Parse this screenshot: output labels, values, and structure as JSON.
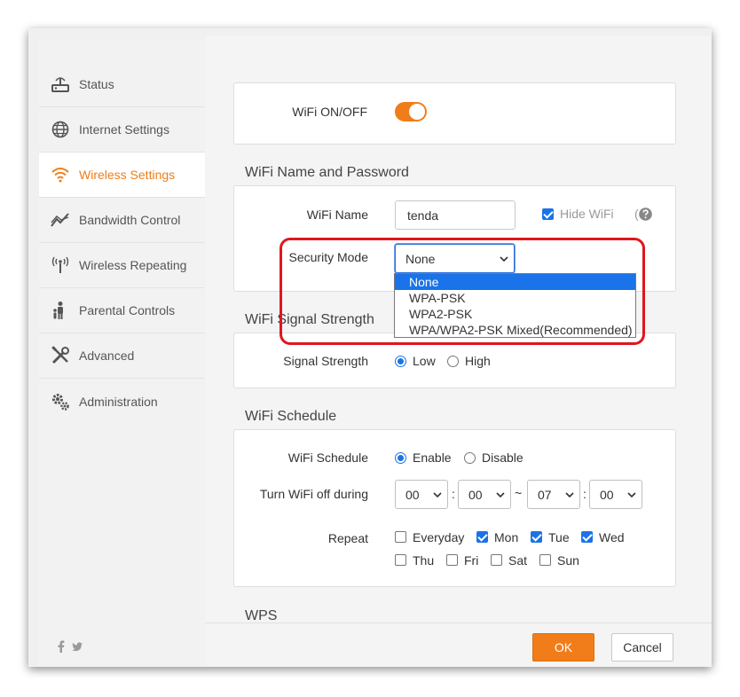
{
  "sidebar": {
    "items": [
      {
        "label": "Status",
        "icon": "router-icon"
      },
      {
        "label": "Internet Settings",
        "icon": "globe-icon"
      },
      {
        "label": "Wireless Settings",
        "icon": "wifi-icon",
        "active": true
      },
      {
        "label": "Bandwidth Control",
        "icon": "chart-line-icon"
      },
      {
        "label": "Wireless Repeating",
        "icon": "antenna-icon"
      },
      {
        "label": "Parental Controls",
        "icon": "family-icon"
      },
      {
        "label": "Advanced",
        "icon": "tools-icon"
      },
      {
        "label": "Administration",
        "icon": "gears-icon"
      }
    ],
    "social": [
      "facebook-icon",
      "twitter-icon"
    ]
  },
  "wifi_switch": {
    "label": "WiFi ON/OFF",
    "state": "on"
  },
  "name_password": {
    "title": "WiFi Name and Password",
    "name_label": "WiFi Name",
    "name_value": "tenda",
    "hide_label": "Hide WiFi",
    "hide_checked": true,
    "help_open": "(",
    "security_label": "Security Mode",
    "security_value": "None",
    "security_options": [
      "None",
      "WPA-PSK",
      "WPA2-PSK",
      "WPA/WPA2-PSK Mixed(Recommended)"
    ]
  },
  "signal": {
    "title": "WiFi Signal Strength",
    "label": "Signal Strength",
    "options": [
      "Low",
      "High"
    ],
    "selected": "Low"
  },
  "schedule": {
    "title": "WiFi Schedule",
    "label": "WiFi Schedule",
    "options": [
      "Enable",
      "Disable"
    ],
    "selected": "Enable",
    "off_label": "Turn WiFi off during",
    "start_hour": "00",
    "start_min": "00",
    "tilde": "~",
    "colon": ":",
    "end_hour": "07",
    "end_min": "00",
    "repeat_label": "Repeat",
    "days": [
      {
        "label": "Everyday",
        "checked": false
      },
      {
        "label": "Mon",
        "checked": true
      },
      {
        "label": "Tue",
        "checked": true
      },
      {
        "label": "Wed",
        "checked": true
      },
      {
        "label": "Thu",
        "checked": false
      },
      {
        "label": "Fri",
        "checked": false
      },
      {
        "label": "Sat",
        "checked": false
      },
      {
        "label": "Sun",
        "checked": false
      }
    ]
  },
  "wps": {
    "title": "WPS"
  },
  "footer": {
    "ok": "OK",
    "cancel": "Cancel"
  },
  "colors": {
    "accent": "#f07d1a",
    "highlight": "#e0161e",
    "select_blue": "#1a73e8"
  }
}
